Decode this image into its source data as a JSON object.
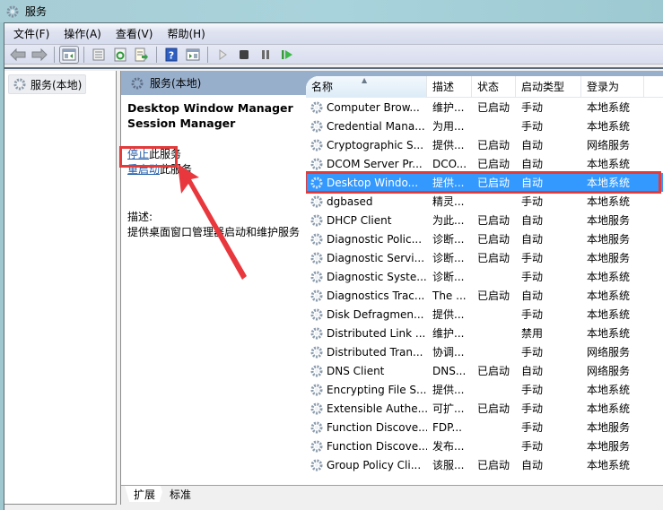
{
  "window": {
    "title": "服务"
  },
  "menu": [
    {
      "label": "文件(F)"
    },
    {
      "label": "操作(A)"
    },
    {
      "label": "查看(V)"
    },
    {
      "label": "帮助(H)"
    }
  ],
  "toolbar": {
    "buttons": [
      {
        "icon": "back-arrow-icon"
      },
      {
        "icon": "forward-arrow-icon"
      },
      {
        "icon": "show-hide-console-tree-icon"
      },
      {
        "icon": "properties-icon"
      },
      {
        "icon": "refresh-icon"
      },
      {
        "icon": "export-list-icon"
      },
      {
        "icon": "help-icon"
      },
      {
        "icon": "show-action-pane-icon"
      },
      {
        "icon": "start-service-icon"
      },
      {
        "icon": "stop-service-icon"
      },
      {
        "icon": "pause-service-icon"
      },
      {
        "icon": "restart-service-icon"
      }
    ]
  },
  "tree": {
    "root_label": "服务(本地)"
  },
  "pane": {
    "header": "服务(本地)",
    "selected_service": {
      "title_line1": "Desktop Window Manager",
      "title_line2": "Session Manager",
      "stop_link": "停止",
      "stop_suffix": "此服务",
      "restart_link": "重启动",
      "restart_suffix": "此服务",
      "description_label": "描述:",
      "description": "提供桌面窗口管理器启动和维护服务"
    },
    "columns": [
      "名称",
      "描述",
      "状态",
      "启动类型",
      "登录为"
    ],
    "rows": [
      {
        "name": "Computer Brow...",
        "desc": "维护...",
        "status": "已启动",
        "startup": "手动",
        "logon": "本地系统"
      },
      {
        "name": "Credential Mana...",
        "desc": "为用...",
        "status": "",
        "startup": "手动",
        "logon": "本地系统"
      },
      {
        "name": "Cryptographic S...",
        "desc": "提供...",
        "status": "已启动",
        "startup": "自动",
        "logon": "网络服务"
      },
      {
        "name": "DCOM Server Pr...",
        "desc": "DCO...",
        "status": "已启动",
        "startup": "自动",
        "logon": "本地系统"
      },
      {
        "name": "Desktop Windo...",
        "desc": "提供...",
        "status": "已启动",
        "startup": "自动",
        "logon": "本地系统",
        "selected": true
      },
      {
        "name": "dgbased",
        "desc": "精灵...",
        "status": "",
        "startup": "手动",
        "logon": "本地系统"
      },
      {
        "name": "DHCP Client",
        "desc": "为此...",
        "status": "已启动",
        "startup": "自动",
        "logon": "本地服务"
      },
      {
        "name": "Diagnostic Polic...",
        "desc": "诊断...",
        "status": "已启动",
        "startup": "自动",
        "logon": "本地服务"
      },
      {
        "name": "Diagnostic Servi...",
        "desc": "诊断...",
        "status": "已启动",
        "startup": "手动",
        "logon": "本地服务"
      },
      {
        "name": "Diagnostic Syste...",
        "desc": "诊断...",
        "status": "",
        "startup": "手动",
        "logon": "本地系统"
      },
      {
        "name": "Diagnostics Trac...",
        "desc": "The ...",
        "status": "已启动",
        "startup": "自动",
        "logon": "本地系统"
      },
      {
        "name": "Disk Defragmen...",
        "desc": "提供...",
        "status": "",
        "startup": "手动",
        "logon": "本地系统"
      },
      {
        "name": "Distributed Link ...",
        "desc": "维护...",
        "status": "",
        "startup": "禁用",
        "logon": "本地系统"
      },
      {
        "name": "Distributed Tran...",
        "desc": "协调...",
        "status": "",
        "startup": "手动",
        "logon": "网络服务"
      },
      {
        "name": "DNS Client",
        "desc": "DNS...",
        "status": "已启动",
        "startup": "自动",
        "logon": "网络服务"
      },
      {
        "name": "Encrypting File S...",
        "desc": "提供...",
        "status": "",
        "startup": "手动",
        "logon": "本地系统"
      },
      {
        "name": "Extensible Authe...",
        "desc": "可扩...",
        "status": "已启动",
        "startup": "手动",
        "logon": "本地系统"
      },
      {
        "name": "Function Discove...",
        "desc": "FDP...",
        "status": "",
        "startup": "手动",
        "logon": "本地服务"
      },
      {
        "name": "Function Discove...",
        "desc": "发布...",
        "status": "",
        "startup": "手动",
        "logon": "本地服务"
      },
      {
        "name": "Group Policy Cli...",
        "desc": "该服...",
        "status": "已启动",
        "startup": "自动",
        "logon": "本地系统"
      }
    ],
    "tabs": [
      {
        "label": "扩展",
        "active": true
      },
      {
        "label": "标准",
        "active": false
      }
    ]
  },
  "colors": {
    "selection": "#3399ff",
    "annotation_red": "#e33a3a",
    "link": "#1e5aa8",
    "pane_header": "#98afcc"
  }
}
